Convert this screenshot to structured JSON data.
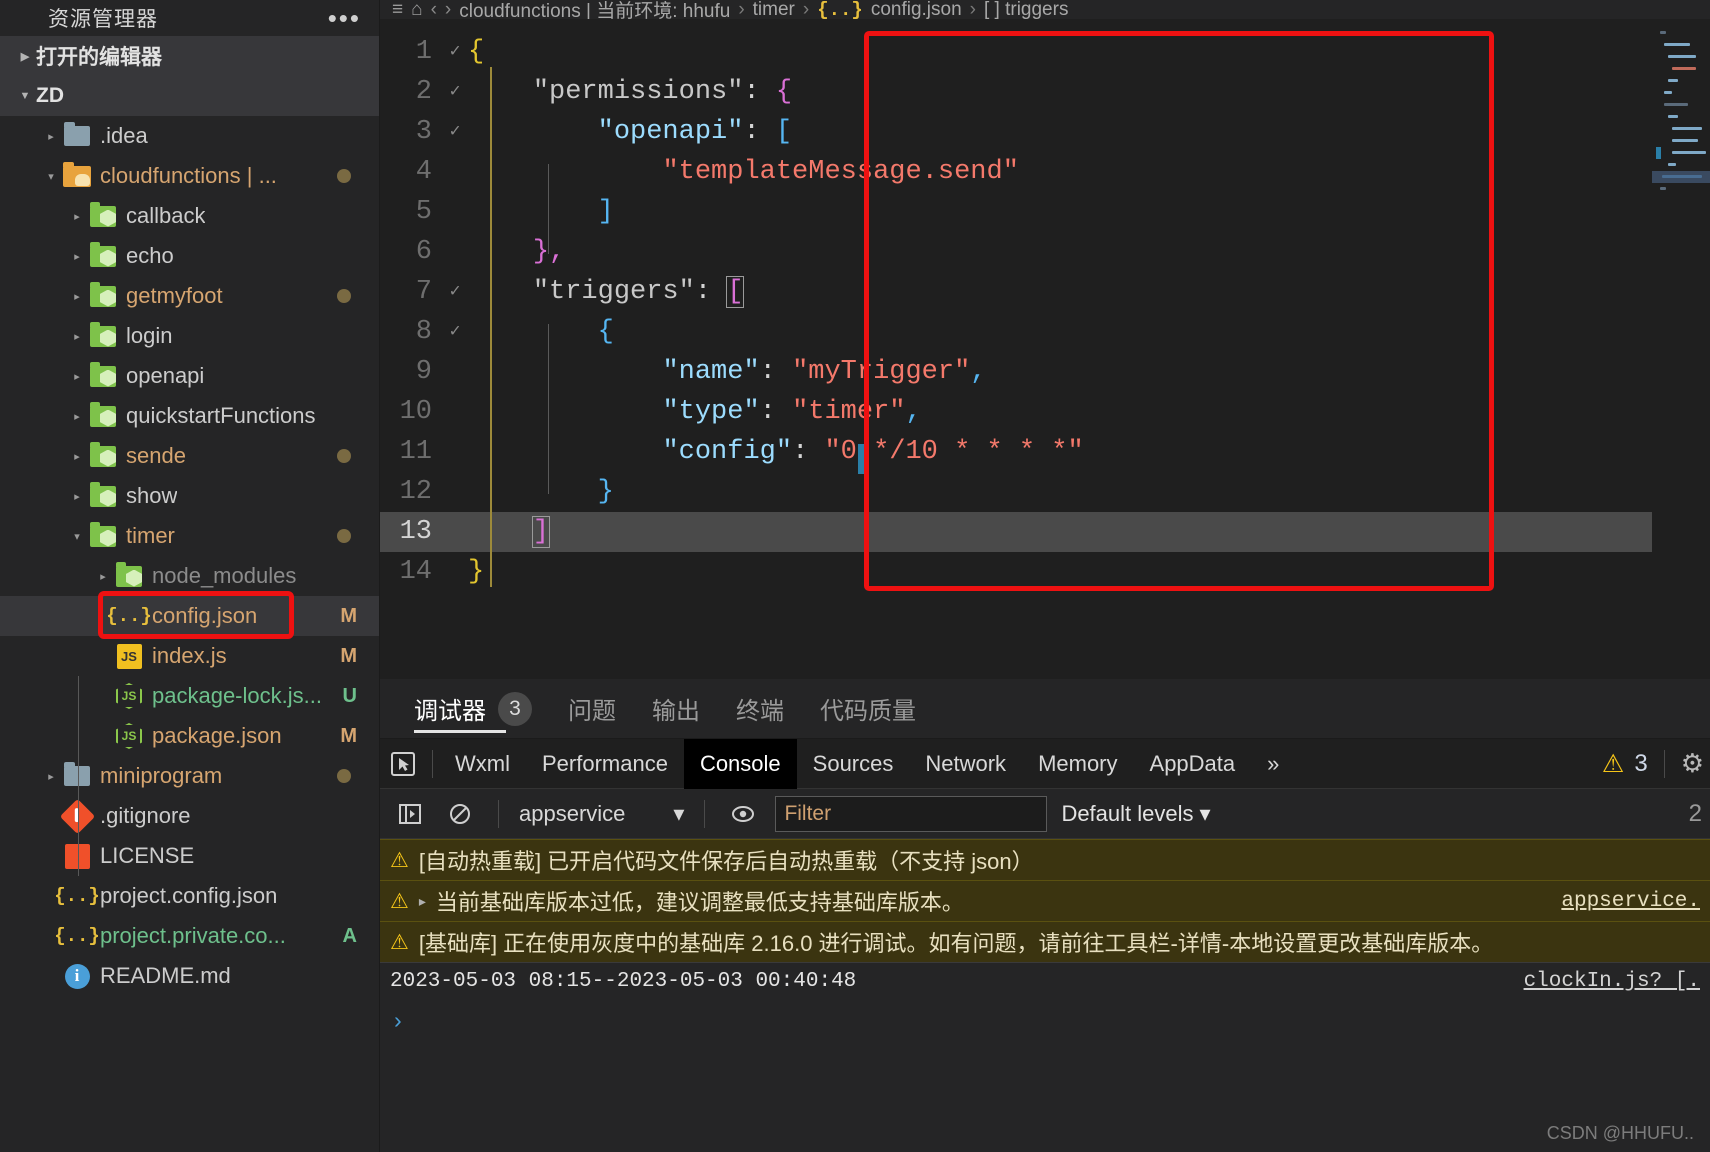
{
  "sidebar": {
    "title": "资源管理器",
    "more_label": "•••",
    "sections": [
      {
        "label": "打开的编辑器",
        "expanded": false
      },
      {
        "label": "ZD",
        "expanded": true
      }
    ],
    "tree": [
      {
        "label": ".idea",
        "icon": "folder-blue-icon",
        "indent": 2,
        "twisty": "▸",
        "badge": "",
        "dot": false,
        "color": "c-white"
      },
      {
        "label": "cloudfunctions | ...",
        "icon": "folder-yellow-open-icon",
        "indent": 2,
        "twisty": "▾",
        "badge": "",
        "dot": true,
        "color": "c-orange"
      },
      {
        "label": "callback",
        "icon": "folder-green-icon",
        "indent": 3,
        "twisty": "▸",
        "badge": "",
        "dot": false,
        "color": "c-white"
      },
      {
        "label": "echo",
        "icon": "folder-green-icon",
        "indent": 3,
        "twisty": "▸",
        "badge": "",
        "dot": false,
        "color": "c-white"
      },
      {
        "label": "getmyfoot",
        "icon": "folder-green-icon",
        "indent": 3,
        "twisty": "▸",
        "badge": "",
        "dot": true,
        "color": "c-orange"
      },
      {
        "label": "login",
        "icon": "folder-green-icon",
        "indent": 3,
        "twisty": "▸",
        "badge": "",
        "dot": false,
        "color": "c-white"
      },
      {
        "label": "openapi",
        "icon": "folder-green-icon",
        "indent": 3,
        "twisty": "▸",
        "badge": "",
        "dot": false,
        "color": "c-white"
      },
      {
        "label": "quickstartFunctions",
        "icon": "folder-green-icon",
        "indent": 3,
        "twisty": "▸",
        "badge": "",
        "dot": false,
        "color": "c-white"
      },
      {
        "label": "sende",
        "icon": "folder-green-icon",
        "indent": 3,
        "twisty": "▸",
        "badge": "",
        "dot": true,
        "color": "c-orange"
      },
      {
        "label": "show",
        "icon": "folder-green-icon",
        "indent": 3,
        "twisty": "▸",
        "badge": "",
        "dot": false,
        "color": "c-white"
      },
      {
        "label": "timer",
        "icon": "folder-green-open-icon",
        "indent": 3,
        "twisty": "▾",
        "badge": "",
        "dot": true,
        "color": "c-orange"
      },
      {
        "label": "node_modules",
        "icon": "folder-green-icon",
        "indent": 4,
        "twisty": "▸",
        "badge": "",
        "dot": false,
        "color": "c-gray"
      },
      {
        "label": "config.json",
        "icon": "json-file-icon",
        "indent": 4,
        "twisty": "",
        "badge": "M",
        "dot": false,
        "color": "c-orange",
        "selected": true,
        "highlighted": true
      },
      {
        "label": "index.js",
        "icon": "js-file-icon",
        "indent": 4,
        "twisty": "",
        "badge": "M",
        "dot": false,
        "color": "c-orange"
      },
      {
        "label": "package-lock.js...",
        "icon": "nodejs-file-icon",
        "indent": 4,
        "twisty": "",
        "badge": "U",
        "dot": false,
        "color": "c-green"
      },
      {
        "label": "package.json",
        "icon": "nodejs-file-icon",
        "indent": 4,
        "twisty": "",
        "badge": "M",
        "dot": false,
        "color": "c-orange"
      },
      {
        "label": "miniprogram",
        "icon": "folder-blue-icon",
        "indent": 2,
        "twisty": "▸",
        "badge": "",
        "dot": true,
        "color": "c-orange"
      },
      {
        "label": ".gitignore",
        "icon": "git-file-icon",
        "indent": 2,
        "twisty": "",
        "badge": "",
        "dot": false,
        "color": "c-white"
      },
      {
        "label": "LICENSE",
        "icon": "license-file-icon",
        "indent": 2,
        "twisty": "",
        "badge": "",
        "dot": false,
        "color": "c-white"
      },
      {
        "label": "project.config.json",
        "icon": "json-file-icon",
        "indent": 2,
        "twisty": "",
        "badge": "",
        "dot": false,
        "color": "c-white"
      },
      {
        "label": "project.private.co...",
        "icon": "json-file-icon",
        "indent": 2,
        "twisty": "",
        "badge": "A",
        "dot": false,
        "color": "c-green"
      },
      {
        "label": "README.md",
        "icon": "readme-file-icon",
        "indent": 2,
        "twisty": "",
        "badge": "",
        "dot": false,
        "color": "c-white"
      }
    ]
  },
  "breadcrumb": {
    "items": [
      "cloudfunctions | 当前环境: hhufu",
      "timer",
      "config.json",
      "[ ] triggers"
    ],
    "separator": "›"
  },
  "editor": {
    "filename": "config.json",
    "current_line": 13,
    "lines": [
      {
        "n": 1,
        "fold": "✓",
        "tokens": [
          {
            "t": "{",
            "c": "t-brace-y"
          }
        ],
        "indent": 0
      },
      {
        "n": 2,
        "fold": "✓",
        "tokens": [
          {
            "t": "\"permissions\"",
            "c": "t-key2"
          },
          {
            "t": ": ",
            "c": "t-punc"
          },
          {
            "t": "{",
            "c": "t-brace-p"
          }
        ],
        "indent": 1
      },
      {
        "n": 3,
        "fold": "✓",
        "tokens": [
          {
            "t": "\"openapi\"",
            "c": "t-key"
          },
          {
            "t": ": ",
            "c": "t-punc"
          },
          {
            "t": "[",
            "c": "t-brace-b"
          }
        ],
        "indent": 2
      },
      {
        "n": 4,
        "fold": "",
        "tokens": [
          {
            "t": "\"templateMessage.send\"",
            "c": "t-str"
          }
        ],
        "indent": 3
      },
      {
        "n": 5,
        "fold": "",
        "tokens": [
          {
            "t": "]",
            "c": "t-brace-b"
          }
        ],
        "indent": 2
      },
      {
        "n": 6,
        "fold": "",
        "tokens": [
          {
            "t": "}",
            "c": "t-brace-p"
          },
          {
            "t": ",",
            "c": "t-brace-p"
          }
        ],
        "indent": 1
      },
      {
        "n": 7,
        "fold": "✓",
        "tokens": [
          {
            "t": "\"triggers\"",
            "c": "t-key2"
          },
          {
            "t": ": ",
            "c": "t-punc"
          },
          {
            "t": "[",
            "c": "t-brace-p",
            "box": true
          }
        ],
        "indent": 1
      },
      {
        "n": 8,
        "fold": "✓",
        "tokens": [
          {
            "t": "{",
            "c": "t-brace-b"
          }
        ],
        "indent": 2
      },
      {
        "n": 9,
        "fold": "",
        "tokens": [
          {
            "t": "\"name\"",
            "c": "t-key"
          },
          {
            "t": ": ",
            "c": "t-punc"
          },
          {
            "t": "\"myTrigger\"",
            "c": "t-str"
          },
          {
            "t": ",",
            "c": "t-brace-b"
          }
        ],
        "indent": 3
      },
      {
        "n": 10,
        "fold": "",
        "tokens": [
          {
            "t": "\"type\"",
            "c": "t-key"
          },
          {
            "t": ": ",
            "c": "t-punc"
          },
          {
            "t": "\"timer\"",
            "c": "t-str"
          },
          {
            "t": ",",
            "c": "t-brace-b"
          }
        ],
        "indent": 3
      },
      {
        "n": 11,
        "fold": "",
        "tokens": [
          {
            "t": "\"config\"",
            "c": "t-key"
          },
          {
            "t": ": ",
            "c": "t-punc"
          },
          {
            "t": "\"0 */10 * * * *\"",
            "c": "t-str"
          }
        ],
        "indent": 3
      },
      {
        "n": 12,
        "fold": "",
        "tokens": [
          {
            "t": "}",
            "c": "t-brace-b"
          }
        ],
        "indent": 2
      },
      {
        "n": 13,
        "fold": "",
        "tokens": [
          {
            "t": "]",
            "c": "t-brace-p",
            "box": true
          }
        ],
        "indent": 1,
        "current": true
      },
      {
        "n": 14,
        "fold": "",
        "tokens": [
          {
            "t": "}",
            "c": "t-brace-y"
          }
        ],
        "indent": 0
      }
    ]
  },
  "panel": {
    "tabs": [
      {
        "label": "调试器",
        "count": "3",
        "active": true
      },
      {
        "label": "问题",
        "count": "",
        "active": false
      },
      {
        "label": "输出",
        "count": "",
        "active": false
      },
      {
        "label": "终端",
        "count": "",
        "active": false
      },
      {
        "label": "代码质量",
        "count": "",
        "active": false
      }
    ]
  },
  "devtools": {
    "inspect_icon": "inspect-cursor-icon",
    "tabs": [
      {
        "label": "Wxml",
        "active": false
      },
      {
        "label": "Performance",
        "active": false
      },
      {
        "label": "Console",
        "active": true
      },
      {
        "label": "Sources",
        "active": false
      },
      {
        "label": "Network",
        "active": false
      },
      {
        "label": "Memory",
        "active": false
      },
      {
        "label": "AppData",
        "active": false
      }
    ],
    "overflow_label": "»",
    "warning_count": "3",
    "settings_icon": "gear-icon",
    "toolbar": {
      "sidebar_toggle_icon": "show-console-sidebar-icon",
      "clear_icon": "clear-console-icon",
      "context_value": "appservice",
      "context_caret": "▾",
      "eye_icon": "live-expression-icon",
      "filter_value": "Filter",
      "filter_placeholder": "Filter",
      "levels_label": "Default levels",
      "levels_caret": "▾",
      "right_count": "2"
    },
    "logs": [
      {
        "kind": "warn",
        "icon": "warning-icon",
        "expander": "",
        "text": "[自动热重载] 已开启代码文件保存后自动热重载（不支持 json）",
        "source": ""
      },
      {
        "kind": "warn",
        "icon": "warning-icon",
        "expander": "▸",
        "text": "当前基础库版本过低，建议调整最低支持基础库版本。",
        "source": "appservice."
      },
      {
        "kind": "warn",
        "icon": "warning-icon",
        "expander": "",
        "text": "[基础库] 正在使用灰度中的基础库 2.16.0 进行调试。如有问题，请前往工具栏-详情-本地设置更改基础库版本。",
        "source": ""
      },
      {
        "kind": "plain",
        "icon": "",
        "expander": "",
        "text": "2023-05-03 08:15--2023-05-03 00:40:48",
        "source": "clockIn.js? [."
      }
    ],
    "prompt_glyph": "›"
  },
  "watermark": "CSDN @HHUFU..",
  "colors": {
    "accent_red": "#ee1111",
    "warn_bg": "#3b3410",
    "string": "#f4796b",
    "key": "#9cdcfe",
    "folder_green": "#7ec24a",
    "folder_yellow": "#e8a33d"
  }
}
